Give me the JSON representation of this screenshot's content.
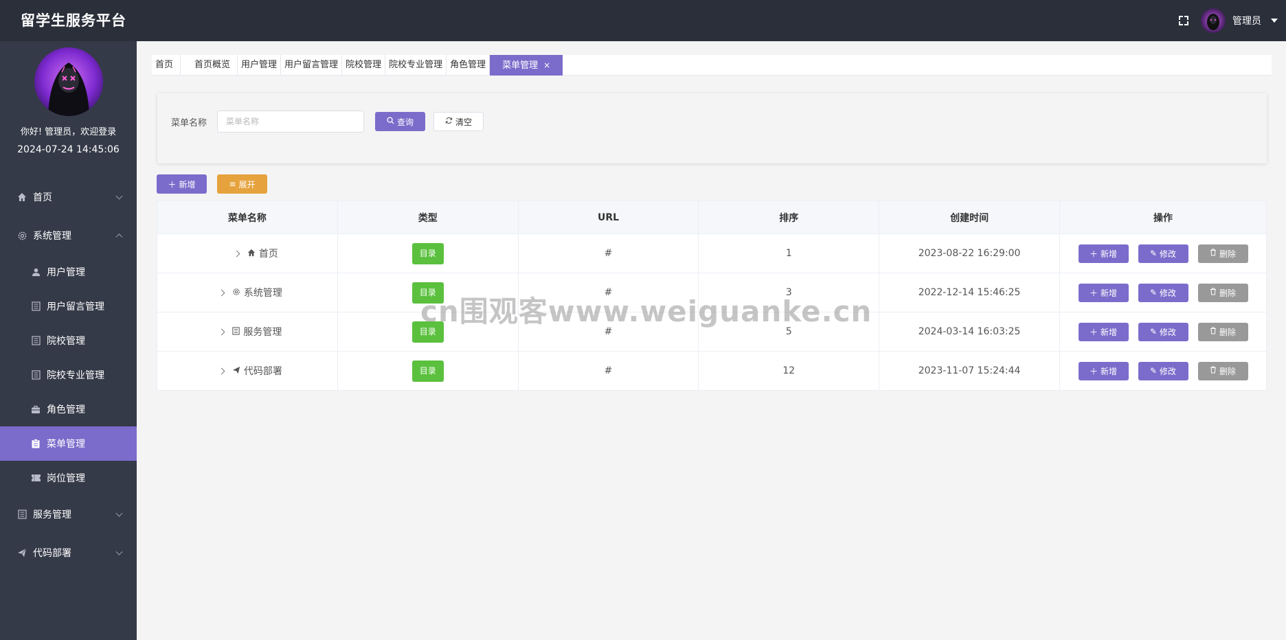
{
  "header": {
    "brand": "留学生服务平台",
    "username": "管理员",
    "icons": [
      "fullscreen-icon",
      "avatar",
      "caret-down-icon"
    ]
  },
  "sidebar": {
    "greeting": "你好! 管理员，欢迎登录",
    "datetime": "2024-07-24 14:45:06",
    "items": [
      {
        "label": "首页",
        "icon": "home-icon",
        "type": "top"
      },
      {
        "label": "系统管理",
        "icon": "gear-icon",
        "type": "top",
        "expanded": true
      },
      {
        "label": "用户管理",
        "icon": "user-icon",
        "type": "sub"
      },
      {
        "label": "用户留言管理",
        "icon": "document-icon",
        "type": "sub"
      },
      {
        "label": "院校管理",
        "icon": "document-icon",
        "type": "sub"
      },
      {
        "label": "院校专业管理",
        "icon": "document-icon",
        "type": "sub"
      },
      {
        "label": "角色管理",
        "icon": "briefcase-icon",
        "type": "sub"
      },
      {
        "label": "菜单管理",
        "icon": "clipboard-icon",
        "type": "sub",
        "active": true
      },
      {
        "label": "岗位管理",
        "icon": "ticket-icon",
        "type": "sub"
      },
      {
        "label": "服务管理",
        "icon": "document-icon",
        "type": "top"
      },
      {
        "label": "代码部署",
        "icon": "send-icon",
        "type": "top"
      }
    ]
  },
  "tabs": [
    {
      "label": "首页"
    },
    {
      "label": "首页概览"
    },
    {
      "label": "用户管理"
    },
    {
      "label": "用户留言管理"
    },
    {
      "label": "院校管理"
    },
    {
      "label": "院校专业管理"
    },
    {
      "label": "角色管理"
    },
    {
      "label": "菜单管理",
      "active": true,
      "close": "×"
    }
  ],
  "search": {
    "label": "菜单名称",
    "placeholder": "菜单名称",
    "query_label": "查询",
    "clear_label": "清空"
  },
  "toolbar": {
    "add_label": "新增",
    "expand_label": "展开"
  },
  "table": {
    "columns": [
      "菜单名称",
      "类型",
      "URL",
      "排序",
      "创建时间",
      "操作"
    ],
    "rows": [
      {
        "name": "首页",
        "icon": "home-icon",
        "type": "目录",
        "url": "#",
        "order": "1",
        "created": "2023-08-22 16:29:00"
      },
      {
        "name": "系统管理",
        "icon": "gear-icon",
        "type": "目录",
        "url": "#",
        "order": "3",
        "created": "2022-12-14 15:46:25"
      },
      {
        "name": "服务管理",
        "icon": "document-icon",
        "type": "目录",
        "url": "#",
        "order": "5",
        "created": "2024-03-14 16:03:25"
      },
      {
        "name": "代码部署",
        "icon": "send-icon",
        "type": "目录",
        "url": "#",
        "order": "12",
        "created": "2023-11-07 15:24:44"
      }
    ],
    "ops": {
      "add": "新增",
      "edit": "修改",
      "delete": "删除"
    }
  },
  "watermark": "cn围观客www.weiguanke.cn",
  "colors": {
    "accent": "#7b6ccb",
    "warning": "#e6a23c",
    "success": "#5ac03d",
    "header": "#2b2f3a",
    "sidebar": "#353a48"
  }
}
